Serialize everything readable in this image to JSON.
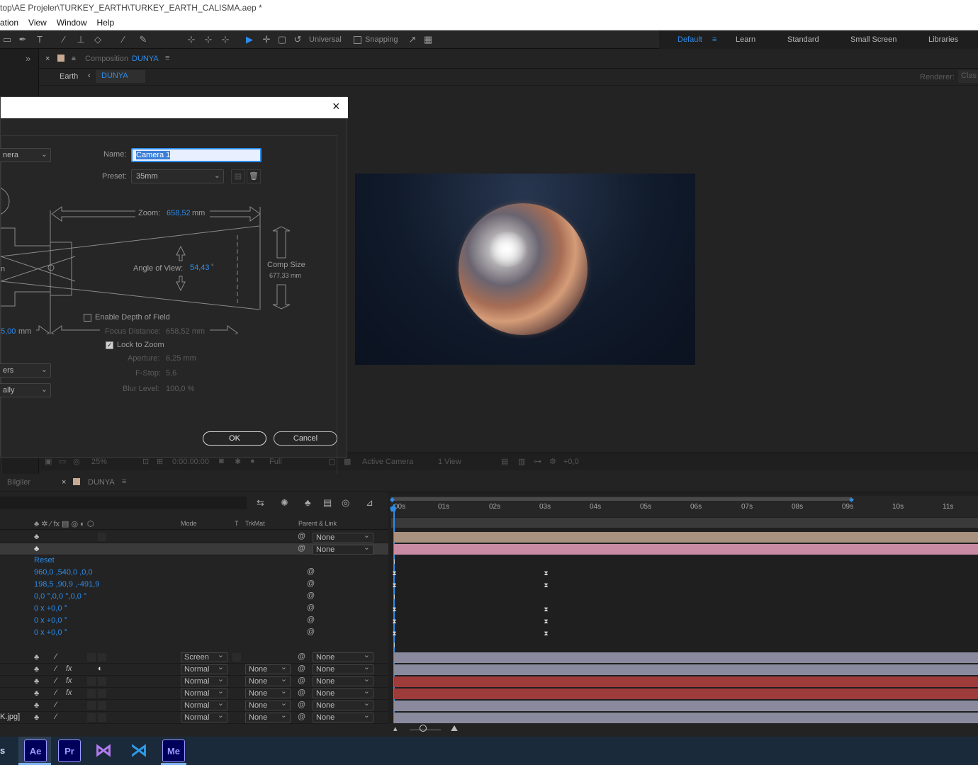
{
  "window": {
    "title": "top\\AE Projeler\\TURKEY_EARTH\\TURKEY_EARTH_CALISMA.aep *"
  },
  "menu": [
    "ation",
    "View",
    "Window",
    "Help"
  ],
  "toolbar": {
    "universal": "Universal",
    "snapping": "Snapping",
    "workspaces": [
      "Default",
      "Learn",
      "Standard",
      "Small Screen",
      "Libraries"
    ],
    "active_workspace": "Default"
  },
  "composition": {
    "tab_prefix": "Composition",
    "tab_name": "DUNYA",
    "breadcrumb_parent": "Earth",
    "breadcrumb_current": "DUNYA",
    "renderer_label": "Renderer:",
    "renderer_value": "Clas"
  },
  "viewer_footer": {
    "zoom": "25%",
    "timecode": "0:00:00:00",
    "resolution": "Full",
    "camera": "Active Camera",
    "views": "1 View",
    "exposure": "+0,0"
  },
  "dialog": {
    "type_partial": "nera",
    "name_label": "Name:",
    "name_value": "Camera 1",
    "preset_label": "Preset:",
    "preset_value": "35mm",
    "zoom_label": "Zoom:",
    "zoom_value": "658,52",
    "zoom_unit": "mm",
    "aov_label": "Angle of View:",
    "aov_value": "54,43",
    "aov_unit": "°",
    "comp_size_label": "Comp Size",
    "comp_size_value": "677,33 mm",
    "film_value": "5,00",
    "film_unit": "mm",
    "h_partial": "n",
    "dof_label": "Enable Depth of Field",
    "focus_label": "Focus Distance:",
    "focus_value": "658,52 mm",
    "lock_label": "Lock to Zoom",
    "aperture_label": "Aperture:",
    "aperture_value": "6,25 mm",
    "fstop_label": "F-Stop:",
    "fstop_value": "5,6",
    "blur_label": "Blur Level:",
    "blur_value": "100,0 %",
    "units_partial": "ers",
    "measure_partial": "ally",
    "ok": "OK",
    "cancel": "Cancel"
  },
  "timeline": {
    "tabs": [
      "Bilgiler",
      "DUNYA"
    ],
    "col_mode": "Mode",
    "col_t": "T",
    "col_trkmat": "TrkMat",
    "col_parent": "Parent & Link",
    "ticks": [
      "00s",
      "01s",
      "02s",
      "03s",
      "04s",
      "05s",
      "06s",
      "07s",
      "08s",
      "09s",
      "10s",
      "11s"
    ],
    "layer_parent_none": "None",
    "props": [
      "Reset",
      "960,0 ,540,0 ,0,0",
      "198,5 ,90,9 ,-491,9",
      "0,0 °,0,0 °,0,0 °",
      "0 x +0,0 °",
      "0 x +0,0 °",
      "0 x +0,0 °"
    ],
    "layers": [
      {
        "mode": "Screen",
        "trkmat": "",
        "parent": "None"
      },
      {
        "mode": "Normal",
        "trkmat": "None",
        "parent": "None"
      },
      {
        "mode": "Normal",
        "trkmat": "None",
        "parent": "None"
      },
      {
        "mode": "Normal",
        "trkmat": "None",
        "parent": "None"
      },
      {
        "mode": "Normal",
        "trkmat": "None",
        "parent": "None"
      },
      {
        "mode": "Normal",
        "trkmat": "None",
        "parent": "None"
      }
    ],
    "last_layer_name": "K.jpg]"
  },
  "taskbar": {
    "apps": [
      {
        "label": "Ae",
        "name": "after-effects",
        "color": "#00005b",
        "fg": "#9999ff"
      },
      {
        "label": "Pr",
        "name": "premiere",
        "color": "#00005b",
        "fg": "#9999ff"
      },
      {
        "label": "VS",
        "name": "visual-studio",
        "color": "#1b2a3b",
        "fg": "#b17cf0"
      },
      {
        "label": "VC",
        "name": "vscode",
        "color": "#1b2a3b",
        "fg": "#2f9be8"
      },
      {
        "label": "Me",
        "name": "media-encoder",
        "color": "#00005b",
        "fg": "#9999ff"
      }
    ]
  }
}
